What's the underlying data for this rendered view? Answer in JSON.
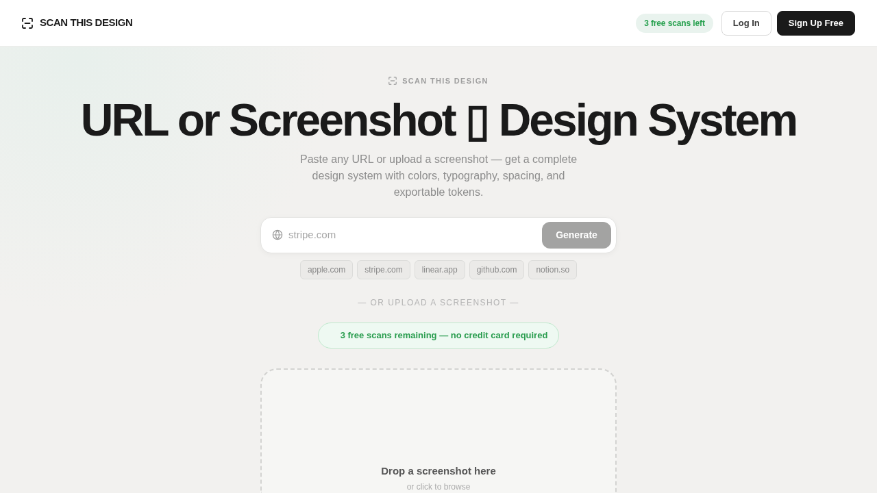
{
  "header": {
    "logo": "SCAN THIS DESIGN",
    "scans_badge": "3 free scans left",
    "buttons": [
      {
        "label": "Log In",
        "kind": "outline"
      },
      {
        "label": "Sign Up Free",
        "kind": "solid"
      }
    ]
  },
  "hero": {
    "eyebrow": "SCAN THIS DESIGN",
    "title": "URL or Screenshot ▯ Design System",
    "subtitle": "Paste any URL or upload a screenshot — get a complete design system with colors, typography, spacing, and exportable tokens."
  },
  "url_form": {
    "placeholder": "stripe.com",
    "button": {
      "label": "Generate",
      "disabled": true
    }
  },
  "suggestions": [
    "apple.com",
    "stripe.com",
    "linear.app",
    "github.com",
    "notion.so"
  ],
  "divider": "— OR UPLOAD A SCREENSHOT —",
  "notice": "3 free scans remaining — no credit card required",
  "dropzone": {
    "title": "Drop a screenshot here",
    "hint": "or click to browse"
  }
}
